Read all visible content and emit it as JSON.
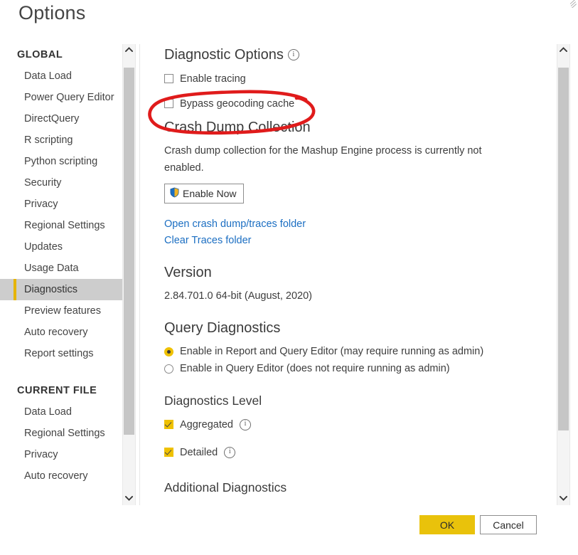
{
  "window": {
    "title": "Options"
  },
  "sidebar": {
    "groups": [
      {
        "title": "GLOBAL",
        "items": [
          {
            "label": "Data Load",
            "selected": false
          },
          {
            "label": "Power Query Editor",
            "selected": false
          },
          {
            "label": "DirectQuery",
            "selected": false
          },
          {
            "label": "R scripting",
            "selected": false
          },
          {
            "label": "Python scripting",
            "selected": false
          },
          {
            "label": "Security",
            "selected": false
          },
          {
            "label": "Privacy",
            "selected": false
          },
          {
            "label": "Regional Settings",
            "selected": false
          },
          {
            "label": "Updates",
            "selected": false
          },
          {
            "label": "Usage Data",
            "selected": false
          },
          {
            "label": "Diagnostics",
            "selected": true
          },
          {
            "label": "Preview features",
            "selected": false
          },
          {
            "label": "Auto recovery",
            "selected": false
          },
          {
            "label": "Report settings",
            "selected": false
          }
        ]
      },
      {
        "title": "CURRENT FILE",
        "items": [
          {
            "label": "Data Load",
            "selected": false
          },
          {
            "label": "Regional Settings",
            "selected": false
          },
          {
            "label": "Privacy",
            "selected": false
          },
          {
            "label": "Auto recovery",
            "selected": false
          }
        ]
      }
    ]
  },
  "main": {
    "diagnostic_options": {
      "heading": "Diagnostic Options",
      "info_glyph": "i",
      "checkboxes": [
        {
          "label": "Enable tracing",
          "checked": false
        },
        {
          "label": "Bypass geocoding cache",
          "checked": false
        }
      ]
    },
    "crash_dump": {
      "heading": "Crash Dump Collection",
      "description": "Crash dump collection for the Mashup Engine process is currently not enabled.",
      "enable_button": "Enable Now",
      "links": [
        "Open crash dump/traces folder",
        "Clear Traces folder"
      ]
    },
    "version": {
      "heading": "Version",
      "value": "2.84.701.0 64-bit (August, 2020)"
    },
    "query_diagnostics": {
      "heading": "Query Diagnostics",
      "radios": [
        {
          "label": "Enable in Report and Query Editor (may require running as admin)",
          "selected": true
        },
        {
          "label": "Enable in Query Editor (does not require running as admin)",
          "selected": false
        }
      ]
    },
    "diagnostics_level": {
      "heading": "Diagnostics Level",
      "checkboxes": [
        {
          "label": "Aggregated",
          "checked": true,
          "info_glyph": "i"
        },
        {
          "label": "Detailed",
          "checked": true,
          "info_glyph": "i"
        }
      ]
    },
    "additional_diagnostics": {
      "heading": "Additional Diagnostics"
    }
  },
  "footer": {
    "ok_label": "OK",
    "cancel_label": "Cancel"
  },
  "annotation": {
    "color": "#e01b1b",
    "target": "Bypass geocoding cache"
  },
  "colors": {
    "accent_gold": "#efc100",
    "ok_button": "#e9c20b",
    "link_blue": "#1b6ec2",
    "selected_nav_bg": "#cdcdcd",
    "scrollbar_thumb": "#c6c6c6",
    "annotation_red": "#e01b1b"
  }
}
